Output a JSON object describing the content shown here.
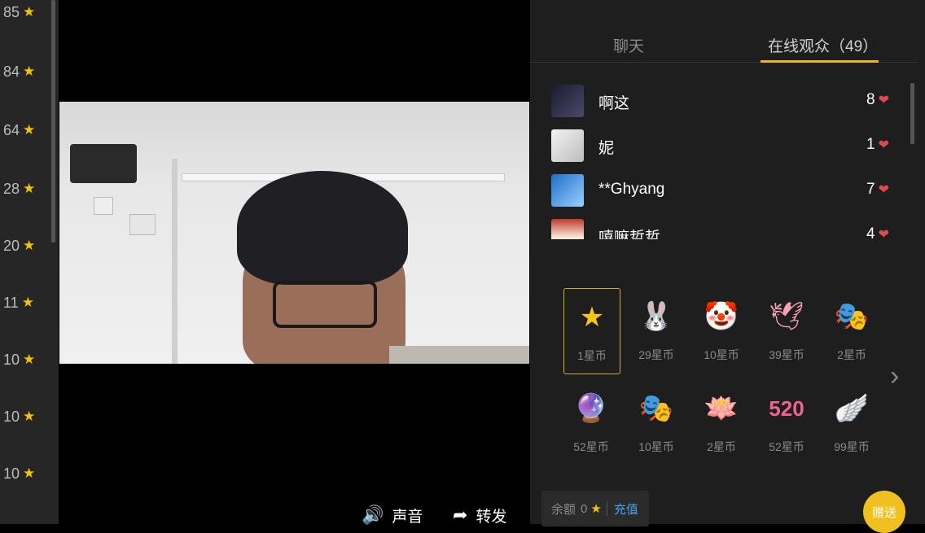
{
  "left_rail": {
    "ranks": [
      {
        "value": "85"
      },
      {
        "value": "84"
      },
      {
        "value": "64"
      },
      {
        "value": "28"
      },
      {
        "value": "20"
      },
      {
        "value": "11"
      },
      {
        "value": "10"
      },
      {
        "value": "10"
      },
      {
        "value": "10"
      }
    ]
  },
  "video": {
    "controls": {
      "sound_label": "声音",
      "share_label": "转发"
    }
  },
  "panel": {
    "tabs": {
      "chat": "聊天",
      "audience": "在线观众（49）"
    },
    "audience": [
      {
        "name": "啊这",
        "count": "8"
      },
      {
        "name": "妮",
        "count": "1"
      },
      {
        "name": "**Ghyang",
        "count": "7"
      },
      {
        "name": "嘻嘛哲哲",
        "count": "4"
      }
    ],
    "gifts": [
      {
        "price": "1星币",
        "icon": "star-gift-icon"
      },
      {
        "price": "29星币",
        "icon": "bunny-gift-icon"
      },
      {
        "price": "10星币",
        "icon": "clown-gift-icon"
      },
      {
        "price": "39星币",
        "icon": "paper-crane-gift-icon"
      },
      {
        "price": "2星币",
        "icon": "jester-gift-icon"
      },
      {
        "price": "52星币",
        "icon": "crystal-ball-gift-icon"
      },
      {
        "price": "10星币",
        "icon": "mask-gift-icon"
      },
      {
        "price": "2星币",
        "icon": "lotus-gift-icon"
      },
      {
        "price": "52星币",
        "icon": "520-gift-icon"
      },
      {
        "price": "99星币",
        "icon": "wings-gift-icon"
      }
    ],
    "balance": {
      "label": "余额",
      "value": "0",
      "recharge": "充值"
    },
    "send_label": "赠送"
  }
}
